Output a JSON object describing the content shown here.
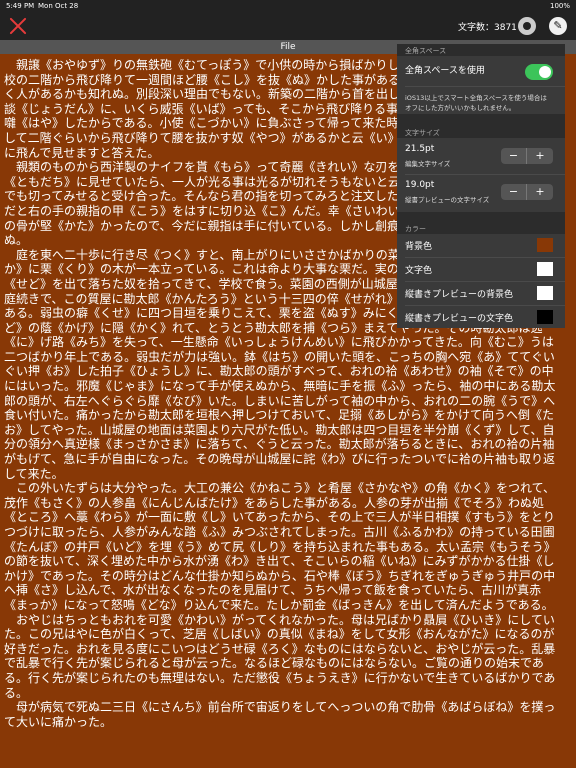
{
  "status": {
    "time": "5:49 PM",
    "date": "Mon Oct 28",
    "battery": "100%"
  },
  "toolbar": {
    "char_count": "文字数：3871"
  },
  "file": {
    "title": "File"
  },
  "body_paragraphs": [
    "親譲《おやゆず》りの無鉄砲《むてっぽう》で小供の時から損ばかりしている。小学校に居る時分学校の二階から飛び降りて一週間ほど腰《こし》を抜《ぬ》かした事がある。なぜそんな無闇をしたと聞く人があるかも知れぬ。別段深い理由でもない。新築の二階から首を出していたら、同級生の一人が冗談《じょうだん》に、いくら威張《いば》っても、そこから飛び降りる事は出来まい。弱虫やーい。と囃《はや》したからである。小使《こづかい》に負ぶさって帰って来た時、おやじが大きな眼《め》をして二階ぐらいから飛び降りて腰を抜かす奴《やつ》があるかと云《い》ったから、この次は抜かさずに飛んで見せますと答えた。",
    "親類のものから西洋製のナイフを貰《もら》って奇麗《きれい》な刃を日に翳《かざ》して、友達《ともだち》に見せていたら、一人が光る事は光るが切れそうもないと云った。切れぬ事があるか、何でも切ってみせると受け合った。そんなら君の指を切ってみろと注文したから、何だ指ぐらいこの通りだと右の手の親指の甲《こう》をはすに切り込《こ》んだ。幸《さいわい》ナイフが小さいのと、親指の骨が堅《かた》かったので、今だに親指は手に付いている。しかし創痕《きずあと》は死ぬまで消えぬ。",
    "庭を東へ二十歩に行き尽《つく》すと、南上がりにいささかばかりの菜園があって、真中《まんなか》に栗《くり》の木が一本立っている。これは命より大事な栗だ。実の熟する時分は起き抜けに背戸《せど》を出て落ちた奴を拾ってきて、学校で食う。菜園の西側が山城屋《やましろや》という質屋の庭続きで、この質屋に勘太郎《かんたろう》という十三四の倅《せがれ》が居た。勘太郎は無論弱虫である。弱虫の癖《くせ》に四つ目垣を乗りこえて、栗を盗《ぬす》みにくる。ある日の夕方折戸《おりど》の蔭《かげ》に隠《かく》れて、とうとう勘太郎を捕《つら》まえてやった。その時勘太郎は逃《に》げ路《みち》を失って、一生懸命《いっしょうけんめい》に飛びかかってきた。向《むこ》うは二つばかり年上である。弱虫だが力は強い。鉢《はち》の開いた頭を、こっちの胸へ宛《あ》ててぐいぐい押《お》した拍子《ひょうし》に、勘太郎の頭がすべって、おれの袷《あわせ》の袖《そで》の中にはいった。邪魔《じゃま》になって手が使えぬから、無暗に手を振《ふ》ったら、袖の中にある勘太郎の頭が、右左へぐらぐら靡《なび》いた。しまいに苦しがって袖の中から、おれの二の腕《うで》へ食い付いた。痛かったから勘太郎を垣根へ押しつけておいて、足搦《あしがら》をかけて向うへ倒《たお》してやった。山城屋の地面は菜園より六尺がた低い。勘太郎は四つ目垣を半分崩《くず》して、自分の領分へ真逆様《まっさかさま》に落ちて、ぐうと云った。勘太郎が落ちるときに、おれの袷の片袖がもげて、急に手が自由になった。その晩母が山城屋に詫《わ》びに行ったついでに袷の片袖も取り返して来た。",
    "この外いたずらは大分やった。大工の兼公《かねこう》と肴屋《さかなや》の角《かく》をつれて、茂作《もさく》の人参畠《にんじんばたけ》をあらした事がある。人参の芽が出揃《でそろ》わぬ処《ところ》へ藁《わら》が一面に敷《し》いてあったから、その上で三人が半日相撲《すもう》をとりつづけに取ったら、人参がみんな踏《ふ》みつぶされてしまった。古川《ふるかわ》の持っている田圃《たんぼ》の井戸《いど》を埋《う》めて尻《しり》を持ち込まれた事もある。太い孟宗《もうそう》の節を抜いて、深く埋めた中から水が湧《わ》き出て、そこいらの稲《いね》にみずがかかる仕掛《しかけ》であった。その時分はどんな仕掛か知らぬから、石や棒《ぼう》ちぎれをぎゅうぎゅう井戸の中へ挿《さ》し込んで、水が出なくなったのを見届けて、うちへ帰って飯を食っていたら、古川が真赤《まっか》になって怒鳴《どな》り込んで来た。たしか罰金《ばっきん》を出して済んだようである。",
    "おやじはちっともおれを可愛《かわい》がってくれなかった。母は兄ばかり贔屓《ひいき》にしていた。この兄はやに色が白くって、芝居《しばい》の真似《まね》をして女形《おんながた》になるのが好きだった。おれを見る度にこいつはどうせ碌《ろく》なものにはならないと、おやじが云った。乱暴で乱暴で行く先が案じられると母が云った。なるほど碌なものにはならない。ご覧の通りの始末である。行く先が案じられたのも無理はない。ただ懲役《ちょうえき》に行かないで生きているばかりである。",
    "母が病気で死ぬ二三日《にさんち》前台所で宙返りをしてへっついの角で肋骨《あばらぼね》を撲って大いに痛かった。"
  ],
  "settings": {
    "section_fullwidth": "全角スペース",
    "fullwidth_toggle_label": "全角スペースを使用",
    "fullwidth_toggle_on": true,
    "fullwidth_note_1": "iOS13以上でスマート全角スペースを使う場合は",
    "fullwidth_note_2": "オフにした方がいいかもしれません。",
    "section_font_size": "文字サイズ",
    "editor_size_value": "21.5pt",
    "editor_size_label": "編集文字サイズ",
    "preview_size_value": "19.0pt",
    "preview_size_label": "縦書プレビューの文字サイズ",
    "section_color": "カラー",
    "color_rows": [
      {
        "label": "背景色",
        "color": "#883806"
      },
      {
        "label": "文字色",
        "color": "#ffffff"
      },
      {
        "label": "縦書きプレビューの背景色",
        "color": "#ffffff"
      },
      {
        "label": "縦書きプレビューの文字色",
        "color": "#000000"
      }
    ],
    "minus": "−",
    "plus": "+"
  }
}
